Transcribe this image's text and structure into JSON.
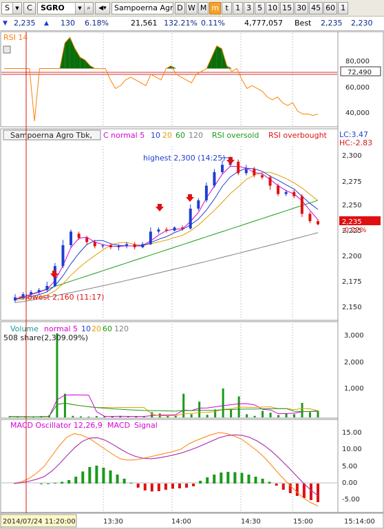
{
  "toolbar": {
    "market_code": "S",
    "type_code": "C",
    "symbol": "SGRO",
    "company_name": "Sampoerna Agro",
    "periods": [
      "D",
      "W",
      "M",
      "m",
      "t",
      "1",
      "3",
      "5",
      "10",
      "15",
      "30",
      "45",
      "60",
      "1"
    ],
    "active_period": "m"
  },
  "quote": {
    "last": "2,235",
    "change": "130",
    "change_pct": "6.18%",
    "volume": "21,561",
    "vol_ratio": "132.21%",
    "turnover_pct": "0.11%",
    "value": "4,777,057",
    "best_label": "Best",
    "best_bid": "2,235",
    "best_ask": "2,230"
  },
  "colors": {
    "rsi_line": "#ff7f00",
    "rsi_fill": "#0a6e0a",
    "up_candle": "#1f3fd0",
    "down_candle": "#e01010",
    "ma5": "#d600d6",
    "ma10": "#1f3fd0",
    "ma20": "#e0a000",
    "ma60": "#1a9a1a",
    "ma120": "#808080",
    "grid": "#c8c8c8"
  },
  "rsi_panel": {
    "title": "RSI 14",
    "axis_labels": [
      "80,000",
      "60,000",
      "40,000"
    ],
    "current_value": "72,490"
  },
  "price_panel": {
    "legend": {
      "name": "Sampoerna Agro Tbk,",
      "ma_label": "C normal 5",
      "ma10": "10",
      "ma20": "20",
      "ma60": "60",
      "ma120": "120",
      "oversold": "RSI oversold",
      "overbought": "RSI overbought"
    },
    "lc": "LC:3.47",
    "hc": "HC:-2.83",
    "axis_labels": [
      "2,300",
      "2,275",
      "2,250",
      "2,225",
      "2,200",
      "2,175",
      "2,150"
    ],
    "current_price": "2,235",
    "current_change": "-0.22%",
    "highest_note": "highest 2,300 (14:25)",
    "lowest_note": "lowest 2,160 (11:17)"
  },
  "volume_panel": {
    "legend": {
      "title": "Volume",
      "ma_label": "normal 5",
      "ma10": "10",
      "ma20": "20",
      "ma60": "60",
      "ma120": "120"
    },
    "share_note": "508 share(2,309.09%)",
    "axis_labels": [
      "3,000",
      "2,000",
      "1,000"
    ]
  },
  "macd_panel": {
    "legend": {
      "title": "MACD Oscillator 12,26,9",
      "macd": "MACD",
      "signal": "Signal"
    },
    "axis_labels": [
      "15.00",
      "10.00",
      "5.00",
      "0.00",
      "-5.00"
    ]
  },
  "time_axis": {
    "cursor_label": "2014/07/24 11:20:00",
    "labels": [
      "13:30",
      "14:00",
      "14:30",
      "15:00"
    ],
    "end_label": "15:14:00"
  },
  "chart_data": {
    "type": "candlestick",
    "title": "Sampoerna Agro Tbk,",
    "ylim": [
      2145,
      2310
    ],
    "rsi_ylim": [
      30,
      95
    ],
    "volume_ylim": [
      0,
      3300
    ],
    "macd_ylim": [
      -8,
      18
    ],
    "candles": [
      {
        "o": 2162,
        "c": 2165,
        "h": 2168,
        "l": 2160
      },
      {
        "o": 2165,
        "c": 2168,
        "h": 2170,
        "l": 2163
      },
      {
        "o": 2168,
        "c": 2170,
        "h": 2172,
        "l": 2166
      },
      {
        "o": 2170,
        "c": 2172,
        "h": 2174,
        "l": 2168
      },
      {
        "o": 2172,
        "c": 2176,
        "h": 2180,
        "l": 2170
      },
      {
        "o": 2176,
        "c": 2195,
        "h": 2198,
        "l": 2175
      },
      {
        "o": 2195,
        "c": 2215,
        "h": 2220,
        "l": 2193
      },
      {
        "o": 2215,
        "c": 2228,
        "h": 2230,
        "l": 2212
      },
      {
        "o": 2226,
        "c": 2222,
        "h": 2228,
        "l": 2220
      },
      {
        "o": 2222,
        "c": 2218,
        "h": 2224,
        "l": 2215
      },
      {
        "o": 2218,
        "c": 2214,
        "h": 2220,
        "l": 2212
      },
      {
        "o": 2214,
        "c": 2215,
        "h": 2216,
        "l": 2212
      },
      {
        "o": 2215,
        "c": 2213,
        "h": 2217,
        "l": 2211
      },
      {
        "o": 2213,
        "c": 2214,
        "h": 2216,
        "l": 2210
      },
      {
        "o": 2214,
        "c": 2216,
        "h": 2218,
        "l": 2212
      },
      {
        "o": 2216,
        "c": 2213,
        "h": 2218,
        "l": 2211
      },
      {
        "o": 2213,
        "c": 2216,
        "h": 2218,
        "l": 2212
      },
      {
        "o": 2216,
        "c": 2228,
        "h": 2232,
        "l": 2215
      },
      {
        "o": 2228,
        "c": 2230,
        "h": 2232,
        "l": 2226
      },
      {
        "o": 2230,
        "c": 2229,
        "h": 2232,
        "l": 2227
      },
      {
        "o": 2229,
        "c": 2232,
        "h": 2233,
        "l": 2228
      },
      {
        "o": 2232,
        "c": 2231,
        "h": 2234,
        "l": 2229
      },
      {
        "o": 2231,
        "c": 2250,
        "h": 2254,
        "l": 2230
      },
      {
        "o": 2250,
        "c": 2258,
        "h": 2260,
        "l": 2248
      },
      {
        "o": 2258,
        "c": 2272,
        "h": 2275,
        "l": 2256
      },
      {
        "o": 2272,
        "c": 2285,
        "h": 2288,
        "l": 2270
      },
      {
        "o": 2285,
        "c": 2292,
        "h": 2296,
        "l": 2283
      },
      {
        "o": 2292,
        "c": 2295,
        "h": 2300,
        "l": 2290
      },
      {
        "o": 2295,
        "c": 2284,
        "h": 2297,
        "l": 2282
      },
      {
        "o": 2284,
        "c": 2288,
        "h": 2292,
        "l": 2282
      },
      {
        "o": 2288,
        "c": 2282,
        "h": 2290,
        "l": 2280
      },
      {
        "o": 2282,
        "c": 2280,
        "h": 2284,
        "l": 2278
      },
      {
        "o": 2280,
        "c": 2272,
        "h": 2282,
        "l": 2268
      },
      {
        "o": 2272,
        "c": 2264,
        "h": 2274,
        "l": 2262
      },
      {
        "o": 2264,
        "c": 2266,
        "h": 2268,
        "l": 2262
      },
      {
        "o": 2266,
        "c": 2262,
        "h": 2268,
        "l": 2260
      },
      {
        "o": 2262,
        "c": 2245,
        "h": 2264,
        "l": 2242
      },
      {
        "o": 2245,
        "c": 2238,
        "h": 2247,
        "l": 2236
      },
      {
        "o": 2238,
        "c": 2235,
        "h": 2240,
        "l": 2234
      }
    ],
    "rsi_values": [
      70,
      70,
      70,
      70,
      70,
      70,
      33,
      70,
      70,
      70,
      70,
      70,
      88,
      92,
      84,
      78,
      76,
      72,
      70,
      70,
      70,
      62,
      56,
      58,
      62,
      64,
      62,
      60,
      58,
      66,
      64,
      62,
      70,
      72,
      66,
      64,
      62,
      60,
      66,
      68,
      70,
      78,
      86,
      84,
      72,
      68,
      70,
      62,
      56,
      58,
      56,
      54,
      50,
      48,
      50,
      46,
      44,
      46,
      40,
      38,
      38,
      37,
      38
    ],
    "volume_values": [
      40,
      20,
      30,
      15,
      50,
      80,
      3200,
      900,
      60,
      40,
      30,
      50,
      40,
      30,
      60,
      20,
      40,
      30,
      200,
      150,
      60,
      80,
      900,
      120,
      600,
      100,
      300,
      1100,
      300,
      800,
      120,
      60,
      250,
      180,
      90,
      150,
      120,
      550,
      200,
      250
    ],
    "macd_osc": [
      0,
      0,
      0.2,
      0.5,
      1,
      2,
      3.5,
      4.8,
      5.2,
      4.6,
      3.8,
      2.6,
      1.4,
      0.2,
      -1.2,
      -2,
      -2.3,
      -2.2,
      -1.8,
      -1.5,
      -1.4,
      -1.2,
      -0.8,
      0.8,
      1.8,
      2.6,
      3.2,
      3.4,
      3.3,
      3.1,
      2.6,
      2,
      1.4,
      0.5,
      -0.6,
      -1.8,
      -2.8,
      -3.6,
      -4.2,
      -4.8,
      -5.4
    ]
  }
}
